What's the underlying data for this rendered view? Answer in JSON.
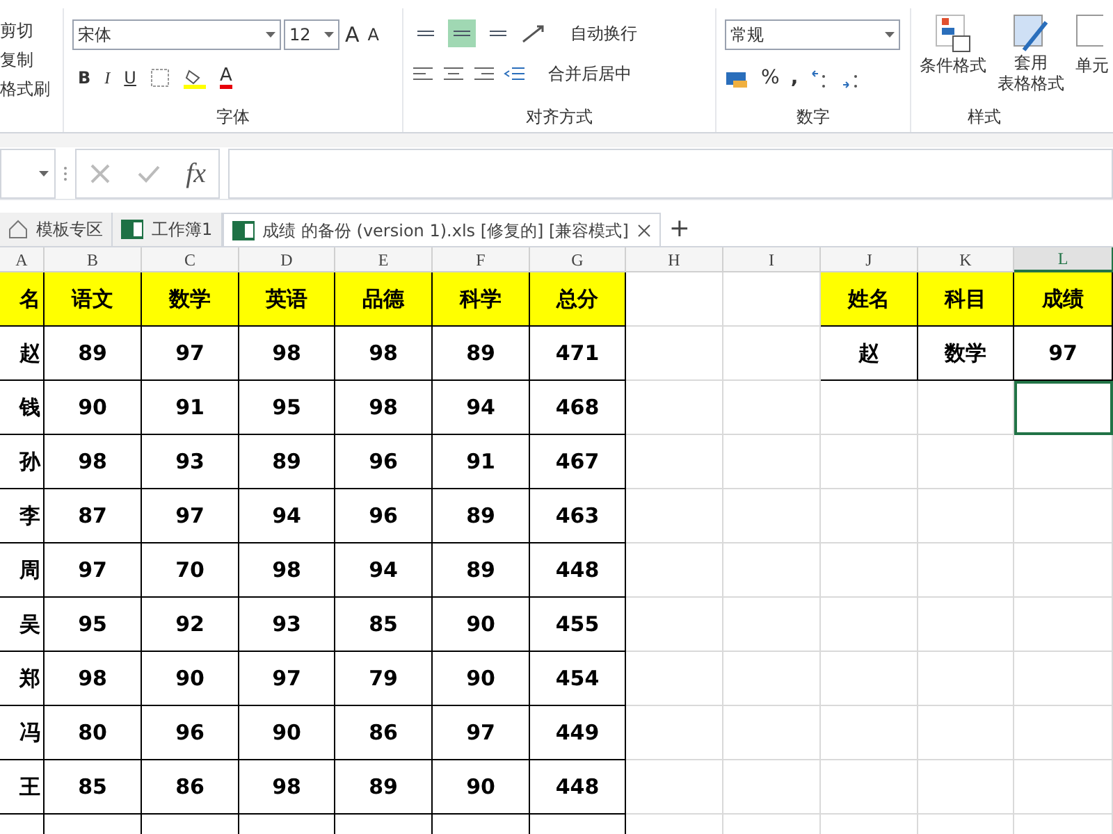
{
  "ribbon": {
    "clipboard": {
      "items": [
        "剪切",
        "复制",
        "格式刷"
      ]
    },
    "font": {
      "label": "字体",
      "font_name": "宋体",
      "font_size": "12",
      "grow": "A",
      "shrink": "A",
      "buttons": [
        "B",
        "I",
        "U"
      ],
      "font_color": "A"
    },
    "alignment": {
      "label": "对齐方式",
      "vertical": [
        {
          "selected": false
        },
        {
          "selected": true
        },
        {
          "selected": false
        }
      ],
      "wrap": "自动换行",
      "merge": "合并后居中"
    },
    "number": {
      "label": "数字",
      "format": "常规",
      "percent": "%",
      "comma": ","
    },
    "styles": {
      "label": "样式",
      "conditional": "条件格式",
      "table_format": [
        "套用",
        "表格格式"
      ],
      "cell_styles": "单元"
    }
  },
  "formula_bar": {
    "fx": "fx"
  },
  "tabs": [
    {
      "label": "模板专区",
      "kind": "home",
      "selected": false
    },
    {
      "label": "工作簿1",
      "kind": "excel",
      "selected": false
    },
    {
      "label": "成绩 的备份 (version 1).xls [修复的]  [兼容模式]",
      "kind": "excel",
      "selected": true
    }
  ],
  "new_tab": "+",
  "columns": [
    {
      "label": "A",
      "selected": false
    },
    {
      "label": "B",
      "selected": false
    },
    {
      "label": "C",
      "selected": false
    },
    {
      "label": "D",
      "selected": false
    },
    {
      "label": "E",
      "selected": false
    },
    {
      "label": "F",
      "selected": false
    },
    {
      "label": "G",
      "selected": false
    },
    {
      "label": "H",
      "selected": false
    },
    {
      "label": "I",
      "selected": false
    },
    {
      "label": "J",
      "selected": false
    },
    {
      "label": "K",
      "selected": false
    },
    {
      "label": "L",
      "selected": true
    }
  ],
  "score_table": {
    "header": [
      "名",
      "语文",
      "数学",
      "英语",
      "品德",
      "科学",
      "总分"
    ],
    "rows": [
      [
        "赵",
        "89",
        "97",
        "98",
        "98",
        "89",
        "471"
      ],
      [
        "钱",
        "90",
        "91",
        "95",
        "98",
        "94",
        "468"
      ],
      [
        "孙",
        "98",
        "93",
        "89",
        "96",
        "91",
        "467"
      ],
      [
        "李",
        "87",
        "97",
        "94",
        "96",
        "89",
        "463"
      ],
      [
        "周",
        "97",
        "70",
        "98",
        "94",
        "89",
        "448"
      ],
      [
        "吴",
        "95",
        "92",
        "93",
        "85",
        "90",
        "455"
      ],
      [
        "郑",
        "98",
        "90",
        "97",
        "79",
        "90",
        "454"
      ],
      [
        "冯",
        "80",
        "96",
        "90",
        "86",
        "97",
        "449"
      ],
      [
        "王",
        "85",
        "86",
        "98",
        "89",
        "90",
        "448"
      ]
    ]
  },
  "lookup_table": {
    "header": [
      "姓名",
      "科目",
      "成绩"
    ],
    "row": [
      "赵",
      "数学",
      "97"
    ]
  }
}
